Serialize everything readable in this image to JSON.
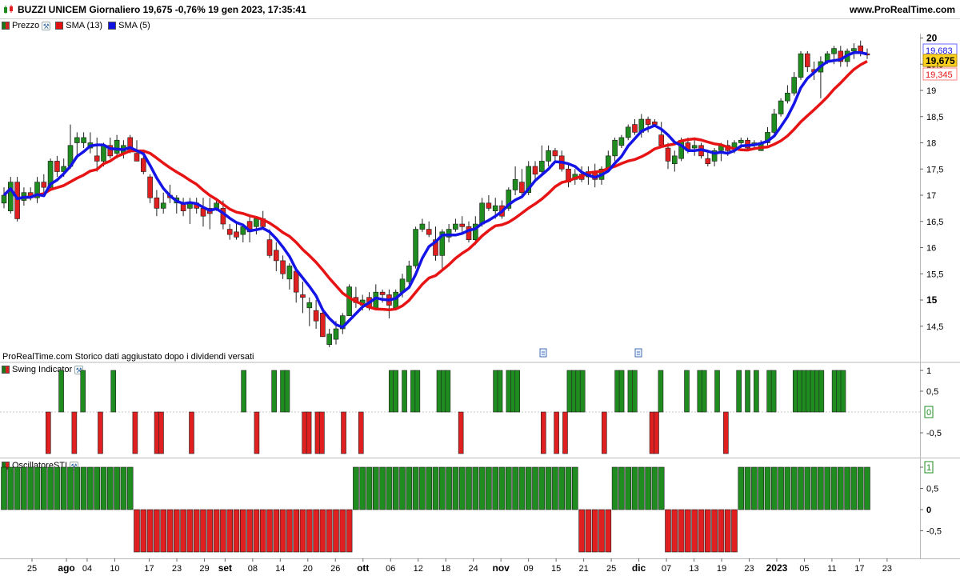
{
  "header": {
    "title": "BUZZI UNICEM Giornaliero 19,675 -0,76% 19 gen 2023, 17:35:41",
    "site": "www.ProRealTime.com"
  },
  "legend_price": [
    {
      "label": "Prezzo",
      "color": "#1a7a1a",
      "color2": "#d92020",
      "wrench": true
    },
    {
      "label": "SMA (13)",
      "color": "#e01010",
      "wrench": false
    },
    {
      "label": "SMA (5)",
      "color": "#1010e0",
      "wrench": false
    }
  ],
  "legend_swing": {
    "label": "Swing Indicator",
    "color": "#1a7a1a",
    "color2": "#d92020"
  },
  "legend_osc": {
    "label": "OscillatoreSTI",
    "color": "#1a7a1a",
    "color2": "#d92020"
  },
  "note": "ProRealTime.com  Storico dati aggiustato dopo i dividendi versati",
  "colors": {
    "up": "#1e8c1e",
    "down": "#e02020",
    "sma13": "#e61414",
    "sma5": "#1414e6"
  },
  "price_labels": {
    "last": "19,675",
    "sma5": "19,683",
    "sma13": "19,345"
  },
  "swing_labels": {
    "current": "0"
  },
  "osc_labels": {
    "current": "1"
  },
  "chart_data": [
    {
      "type": "candlestick",
      "title": "BUZZI UNICEM Giornaliero",
      "ylim": [
        14,
        20.1
      ],
      "y_ticks": [
        "20",
        "19,5",
        "19",
        "18,5",
        "18",
        "17,5",
        "17",
        "16,5",
        "16",
        "15,5",
        "15",
        "14,5"
      ],
      "y_tick_values": [
        20,
        19.5,
        19,
        18.5,
        18,
        17.5,
        17,
        16.5,
        16,
        15.5,
        15,
        14.5
      ],
      "x_tick_labels": [
        "25",
        "ago",
        "04",
        "10",
        "17",
        "23",
        "29",
        "set",
        "08",
        "14",
        "20",
        "26",
        "ott",
        "06",
        "12",
        "18",
        "24",
        "nov",
        "09",
        "15",
        "21",
        "25",
        "dic",
        "07",
        "13",
        "19",
        "23",
        "2023",
        "05",
        "11",
        "17",
        "23"
      ],
      "x_tick_days": [
        0,
        5,
        8,
        12,
        17,
        21,
        25,
        28,
        32,
        36,
        40,
        44,
        48,
        52,
        56,
        60,
        64,
        68,
        72,
        76,
        80,
        84,
        88,
        92,
        96,
        100,
        104,
        108,
        112,
        116,
        120,
        124
      ],
      "ohlc": [
        [
          16.85,
          17.15,
          16.75,
          17.0
        ],
        [
          16.7,
          17.35,
          16.65,
          17.25
        ],
        [
          17.25,
          17.35,
          16.5,
          16.55
        ],
        [
          16.9,
          17.15,
          16.8,
          17.05
        ],
        [
          17.05,
          17.15,
          16.9,
          16.95
        ],
        [
          16.95,
          17.35,
          16.85,
          17.25
        ],
        [
          17.25,
          17.4,
          17.05,
          17.15
        ],
        [
          17.15,
          17.7,
          17.1,
          17.65
        ],
        [
          17.65,
          17.75,
          17.35,
          17.45
        ],
        [
          17.45,
          17.7,
          17.35,
          17.55
        ],
        [
          17.55,
          18.35,
          17.5,
          17.95
        ],
        [
          18.0,
          18.2,
          17.7,
          18.1
        ],
        [
          18.0,
          18.2,
          17.9,
          18.1
        ],
        [
          17.9,
          18.2,
          17.8,
          18.0
        ],
        [
          17.75,
          18.1,
          17.45,
          17.65
        ],
        [
          17.65,
          18.0,
          17.55,
          17.95
        ],
        [
          17.95,
          18.1,
          17.7,
          17.75
        ],
        [
          17.8,
          18.15,
          17.7,
          18.05
        ],
        [
          17.8,
          18.05,
          17.7,
          17.95
        ],
        [
          18.1,
          18.15,
          17.8,
          17.85
        ],
        [
          17.8,
          18.05,
          17.65,
          17.65
        ],
        [
          17.7,
          17.8,
          17.4,
          17.45
        ],
        [
          17.35,
          17.4,
          16.85,
          16.95
        ],
        [
          16.95,
          17.1,
          16.6,
          16.75
        ],
        [
          16.75,
          17.05,
          16.65,
          16.85
        ],
        [
          17.0,
          17.2,
          16.85,
          16.95
        ],
        [
          16.85,
          17.0,
          16.65,
          16.95
        ],
        [
          16.85,
          16.95,
          16.6,
          16.7
        ],
        [
          16.75,
          16.95,
          16.45,
          16.85
        ],
        [
          16.85,
          16.95,
          16.65,
          16.75
        ],
        [
          16.75,
          16.95,
          16.4,
          16.6
        ],
        [
          16.75,
          16.95,
          16.35,
          16.65
        ],
        [
          16.75,
          16.95,
          16.7,
          16.85
        ],
        [
          16.75,
          16.9,
          16.35,
          16.45
        ],
        [
          16.35,
          16.45,
          16.15,
          16.25
        ],
        [
          16.3,
          16.5,
          16.15,
          16.2
        ],
        [
          16.25,
          16.45,
          16.1,
          16.4
        ],
        [
          16.5,
          16.6,
          16.1,
          16.3
        ],
        [
          16.4,
          16.55,
          16.25,
          16.55
        ],
        [
          16.55,
          16.7,
          16.35,
          16.4
        ],
        [
          16.15,
          16.35,
          15.8,
          15.85
        ],
        [
          15.95,
          16.1,
          15.55,
          15.75
        ],
        [
          15.75,
          15.85,
          15.4,
          15.5
        ],
        [
          15.4,
          15.7,
          15.2,
          15.65
        ],
        [
          15.55,
          15.6,
          14.95,
          15.15
        ],
        [
          15.1,
          15.35,
          14.75,
          15.05
        ],
        [
          14.85,
          15.05,
          14.5,
          14.95
        ],
        [
          14.8,
          15.0,
          14.45,
          14.6
        ],
        [
          14.75,
          14.8,
          14.3,
          14.3
        ],
        [
          14.15,
          14.45,
          14.1,
          14.35
        ],
        [
          14.25,
          14.6,
          14.15,
          14.45
        ],
        [
          14.45,
          14.75,
          14.35,
          14.7
        ],
        [
          14.7,
          15.3,
          14.7,
          15.25
        ],
        [
          15.05,
          15.25,
          14.85,
          14.95
        ],
        [
          14.9,
          15.1,
          14.8,
          15.0
        ],
        [
          15.05,
          15.15,
          14.8,
          14.85
        ],
        [
          14.85,
          15.3,
          14.8,
          15.15
        ],
        [
          15.15,
          15.2,
          14.95,
          15.1
        ],
        [
          15.1,
          15.2,
          14.65,
          14.9
        ],
        [
          14.85,
          15.2,
          14.8,
          15.15
        ],
        [
          15.15,
          15.5,
          15.05,
          15.4
        ],
        [
          15.35,
          15.75,
          15.3,
          15.65
        ],
        [
          15.65,
          16.4,
          15.6,
          16.35
        ],
        [
          16.35,
          16.55,
          16.3,
          16.45
        ],
        [
          16.35,
          16.5,
          16.2,
          16.25
        ],
        [
          16.15,
          16.4,
          15.75,
          15.85
        ],
        [
          15.85,
          16.35,
          15.6,
          16.3
        ],
        [
          16.2,
          16.45,
          16.1,
          16.35
        ],
        [
          16.35,
          16.55,
          16.3,
          16.45
        ],
        [
          16.45,
          16.6,
          16.25,
          16.4
        ],
        [
          16.4,
          16.5,
          16.1,
          16.15
        ],
        [
          16.15,
          16.6,
          16.05,
          16.45
        ],
        [
          16.45,
          16.95,
          16.4,
          16.85
        ],
        [
          16.85,
          17.0,
          16.7,
          16.75
        ],
        [
          16.7,
          16.95,
          16.55,
          16.8
        ],
        [
          16.8,
          16.9,
          16.55,
          16.6
        ],
        [
          16.75,
          17.15,
          16.7,
          17.1
        ],
        [
          17.1,
          17.55,
          17.0,
          17.3
        ],
        [
          17.25,
          17.5,
          16.95,
          17.05
        ],
        [
          17.05,
          17.65,
          17.0,
          17.55
        ],
        [
          17.55,
          17.65,
          17.25,
          17.4
        ],
        [
          17.45,
          17.95,
          17.4,
          17.65
        ],
        [
          17.65,
          17.95,
          17.55,
          17.85
        ],
        [
          17.85,
          17.9,
          17.65,
          17.75
        ],
        [
          17.75,
          17.85,
          17.45,
          17.5
        ],
        [
          17.5,
          17.6,
          17.15,
          17.25
        ],
        [
          17.3,
          17.5,
          17.2,
          17.4
        ],
        [
          17.4,
          17.55,
          17.25,
          17.3
        ],
        [
          17.35,
          17.55,
          17.2,
          17.45
        ],
        [
          17.45,
          17.6,
          17.15,
          17.3
        ],
        [
          17.3,
          17.55,
          17.2,
          17.5
        ],
        [
          17.5,
          17.85,
          17.45,
          17.75
        ],
        [
          17.75,
          18.1,
          17.65,
          18.05
        ],
        [
          17.95,
          18.15,
          17.9,
          18.1
        ],
        [
          18.1,
          18.35,
          18.05,
          18.3
        ],
        [
          18.35,
          18.45,
          18.15,
          18.2
        ],
        [
          18.2,
          18.55,
          18.1,
          18.45
        ],
        [
          18.45,
          18.5,
          18.2,
          18.35
        ],
        [
          18.4,
          18.45,
          18.3,
          18.35
        ],
        [
          18.15,
          18.4,
          17.9,
          17.95
        ],
        [
          17.9,
          18.0,
          17.5,
          17.65
        ],
        [
          17.6,
          17.85,
          17.45,
          17.75
        ],
        [
          17.7,
          18.1,
          17.65,
          18.05
        ],
        [
          18.0,
          18.1,
          17.8,
          17.85
        ],
        [
          17.9,
          18.1,
          17.75,
          17.95
        ],
        [
          17.95,
          18.0,
          17.7,
          17.75
        ],
        [
          17.7,
          17.85,
          17.55,
          17.6
        ],
        [
          17.65,
          17.9,
          17.55,
          17.85
        ],
        [
          17.85,
          18.0,
          17.65,
          17.95
        ],
        [
          17.95,
          18.05,
          17.75,
          17.85
        ],
        [
          17.9,
          18.05,
          17.8,
          18.0
        ],
        [
          18.0,
          18.1,
          17.9,
          18.05
        ],
        [
          18.05,
          18.1,
          17.85,
          17.9
        ],
        [
          17.95,
          18.05,
          17.9,
          18.0
        ],
        [
          17.85,
          18.05,
          17.85,
          18.0
        ],
        [
          18.0,
          18.3,
          17.95,
          18.2
        ],
        [
          18.2,
          18.65,
          18.1,
          18.55
        ],
        [
          18.55,
          18.85,
          18.5,
          18.8
        ],
        [
          18.8,
          19.1,
          18.75,
          18.95
        ],
        [
          18.95,
          19.35,
          18.9,
          19.25
        ],
        [
          19.25,
          19.75,
          19.2,
          19.7
        ],
        [
          19.7,
          19.75,
          19.35,
          19.45
        ],
        [
          19.4,
          19.55,
          19.2,
          19.35
        ],
        [
          19.35,
          19.65,
          18.85,
          19.55
        ],
        [
          19.55,
          19.75,
          19.5,
          19.7
        ],
        [
          19.7,
          19.85,
          19.5,
          19.8
        ],
        [
          19.75,
          19.85,
          19.45,
          19.55
        ],
        [
          19.55,
          19.8,
          19.45,
          19.75
        ],
        [
          19.75,
          19.9,
          19.6,
          19.8
        ],
        [
          19.85,
          19.95,
          19.65,
          19.7
        ],
        [
          19.7,
          19.8,
          19.6,
          19.675
        ]
      ],
      "series": [
        {
          "name": "SMA (13)",
          "color": "#e61414"
        },
        {
          "name": "SMA (5)",
          "color": "#1414e6"
        }
      ]
    },
    {
      "type": "bar",
      "title": "Swing Indicator",
      "ylim": [
        -1,
        1.05
      ],
      "y_ticks": [
        "1",
        "0,5",
        "-0,5"
      ],
      "y_tick_values": [
        1,
        0.5,
        -0.5
      ],
      "values": [
        0,
        0,
        0,
        0,
        0,
        0,
        0,
        0,
        0,
        0,
        -1,
        0,
        0,
        1,
        0,
        0,
        -1,
        0,
        1,
        0,
        0,
        0,
        -1,
        0,
        0,
        1,
        0,
        0,
        0,
        0,
        -1,
        0,
        0,
        0,
        0,
        -1,
        -1,
        0,
        0,
        0,
        0,
        0,
        0,
        -1,
        0,
        0,
        0,
        0,
        0,
        0,
        0,
        0,
        0,
        0,
        0,
        1,
        0,
        0,
        -1,
        0,
        0,
        0,
        1,
        0,
        1,
        1,
        0,
        0,
        0,
        -1,
        -1,
        0,
        -1,
        -1,
        0,
        0,
        0,
        0,
        -1,
        0,
        0,
        0,
        -1,
        0,
        0,
        0,
        0,
        0,
        0,
        1,
        1,
        0,
        1,
        0,
        1,
        1,
        0,
        0,
        0,
        0,
        1,
        1,
        1,
        0,
        0,
        -1,
        0,
        0,
        0,
        0,
        0,
        0,
        0,
        1,
        1,
        0,
        1,
        1,
        1,
        0,
        0,
        0,
        0,
        0,
        -1,
        0,
        0,
        -1,
        0,
        -1,
        1,
        1,
        1,
        1,
        0,
        0,
        0,
        0,
        -1,
        0,
        0,
        1,
        1,
        0,
        1,
        1,
        0,
        0,
        0,
        -1,
        -1,
        1,
        0,
        0,
        0,
        0,
        0,
        1,
        0,
        0,
        1,
        1,
        0,
        0,
        1,
        0,
        -1,
        0,
        0,
        1,
        0,
        1,
        0,
        1,
        0,
        0,
        1,
        1,
        0,
        0,
        0,
        0,
        1,
        1,
        1,
        1,
        1,
        1,
        1,
        0,
        0,
        1,
        1,
        1,
        0,
        0,
        0,
        0,
        0,
        0,
        0,
        0,
        0,
        0,
        0,
        0,
        0,
        0,
        0,
        0
      ]
    },
    {
      "type": "bar",
      "title": "OscillatoreSTI",
      "ylim": [
        -1,
        1.05
      ],
      "y_ticks": [
        "1",
        "0,5",
        "0",
        "-0,5"
      ],
      "y_tick_values": [
        1,
        0.5,
        0,
        -0.5
      ],
      "values_runs": [
        [
          1,
          20
        ],
        [
          -1,
          33
        ],
        [
          1,
          34
        ],
        [
          -1,
          5
        ],
        [
          1,
          8
        ],
        [
          -1,
          11
        ],
        [
          1,
          20
        ]
      ]
    }
  ]
}
